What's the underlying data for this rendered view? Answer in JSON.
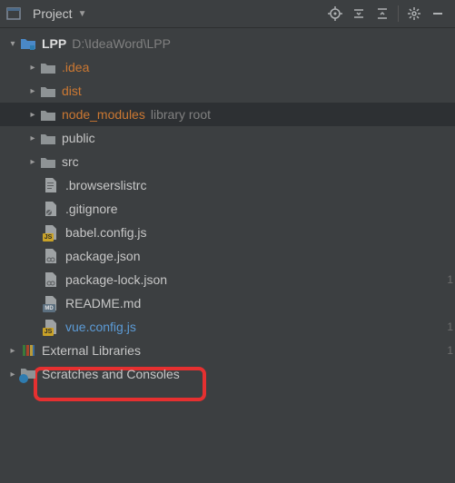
{
  "toolbar": {
    "title": "Project"
  },
  "project": {
    "name": "LPP",
    "path": "D:\\IdeaWord\\LPP"
  },
  "folders": {
    "idea": ".idea",
    "dist": "dist",
    "node_modules": "node_modules",
    "node_modules_note": "library root",
    "public": "public",
    "src": "src"
  },
  "files": {
    "browserslist": ".browserslistrc",
    "gitignore": ".gitignore",
    "babel": "babel.config.js",
    "pkg": "package.json",
    "pkglock": "package-lock.json",
    "readme": "README.md",
    "vueconf": "vue.config.js"
  },
  "extlib": "External Libraries",
  "scratches": "Scratches and Consoles",
  "gutter": {
    "a": "1",
    "b": "1",
    "c": "1"
  }
}
